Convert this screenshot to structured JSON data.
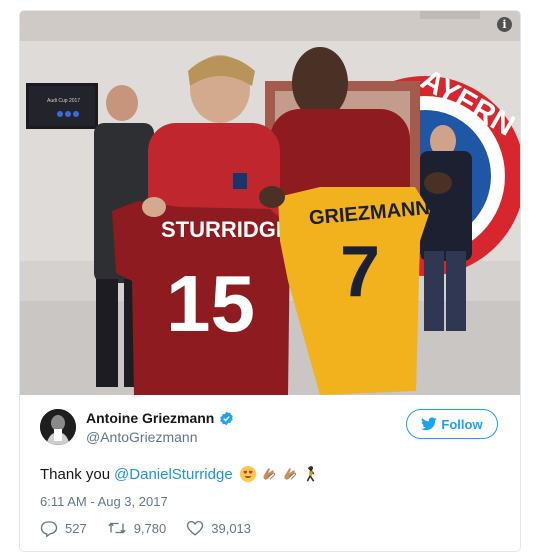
{
  "photo": {
    "left_shirt_name": "STURRIDGE",
    "left_shirt_number": "15",
    "right_shirt_name": "GRIEZMANN",
    "right_shirt_number": "7",
    "wall_logo_text": "AYERN",
    "tv_text": "Audi Cup 2017",
    "info_icon": "i"
  },
  "tweet": {
    "author_name": "Antoine Griezmann",
    "author_handle": "@AntoGriezmann",
    "follow_label": "Follow",
    "text": "Thank you",
    "mention": "@DanielSturridge",
    "timestamp": "6:11 AM - Aug 3, 2017",
    "replies": "527",
    "retweets": "9,780",
    "likes": "39,013"
  },
  "colors": {
    "accent": "#1da1f2",
    "mention": "#1b95e0",
    "secondary_text": "#657786",
    "liverpool_red": "#8e1b1f",
    "atletico_yellow": "#f2b21e"
  },
  "icons": [
    "info-icon",
    "verified-badge-icon",
    "twitter-bird-icon",
    "reply-icon",
    "retweet-icon",
    "like-icon",
    "heart-eyes-emoji",
    "clap-emoji",
    "clap-emoji",
    "dancer-emoji"
  ]
}
